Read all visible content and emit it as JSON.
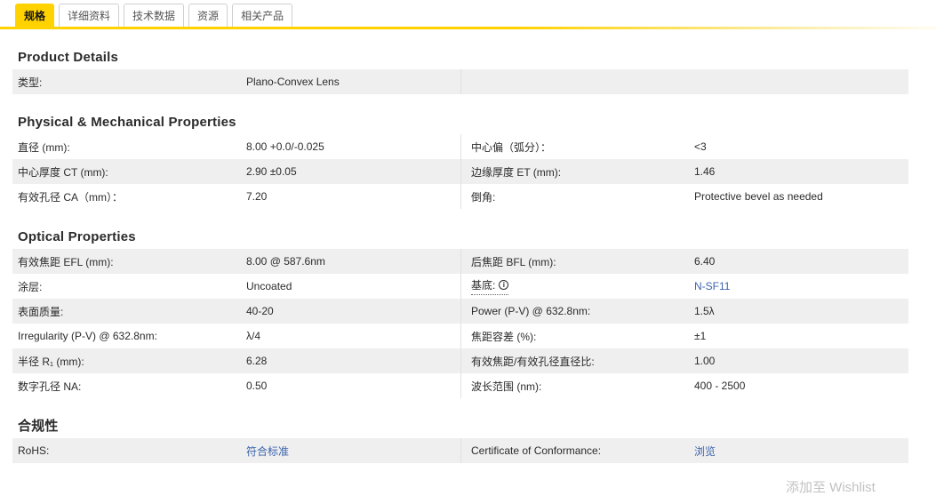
{
  "tabs": [
    {
      "label": "规格",
      "active": true
    },
    {
      "label": "详细资料",
      "active": false
    },
    {
      "label": "技术数据",
      "active": false
    },
    {
      "label": "资源",
      "active": false
    },
    {
      "label": "相关产品",
      "active": false
    }
  ],
  "icons": {
    "info": "i"
  },
  "overlay": {
    "partial_text": "添加至 Wishlist"
  },
  "colors": {
    "accent_yellow": "#ffd200",
    "row_gray": "#efefef",
    "link_blue": "#3b63ad",
    "text": "#2b2b2b"
  },
  "sections": [
    {
      "title": "Product Details",
      "rows": [
        {
          "left": {
            "label": "类型:",
            "value": "Plano-Convex Lens"
          }
        }
      ]
    },
    {
      "title": "Physical & Mechanical Properties",
      "rows": [
        {
          "left": {
            "label": "直径 (mm):",
            "value": "8.00 +0.0/-0.025"
          },
          "right": {
            "label": "中心偏（弧分）：",
            "value": "<3"
          }
        },
        {
          "left": {
            "label": "中心厚度 CT (mm):",
            "value": "2.90 ±0.05"
          },
          "right": {
            "label": "边缘厚度 ET (mm):",
            "value": "1.46"
          }
        },
        {
          "left": {
            "label": "有效孔径 CA（mm）：",
            "value": "7.20"
          },
          "right": {
            "label": "倒角:",
            "value": "Protective bevel as needed"
          }
        }
      ]
    },
    {
      "title": "Optical Properties",
      "rows": [
        {
          "left": {
            "label": "有效焦距 EFL (mm):",
            "value": "8.00 @ 587.6nm"
          },
          "right": {
            "label": "后焦距 BFL (mm):",
            "value": "6.40"
          }
        },
        {
          "left": {
            "label": "涂层:",
            "value": "Uncoated"
          },
          "right": {
            "label": "基底:",
            "value": "N-SF11"
          }
        },
        {
          "left": {
            "label": "表面质量:",
            "value": "40-20"
          },
          "right": {
            "label": "Power (P-V) @ 632.8nm:",
            "value": "1.5λ"
          }
        },
        {
          "left": {
            "label": "Irregularity (P-V) @ 632.8nm:",
            "value": "λ/4"
          },
          "right": {
            "label": "焦距容差 (%):",
            "value": "±1"
          }
        },
        {
          "left": {
            "label": "半径 R₁ (mm):",
            "value": "6.28"
          },
          "right": {
            "label": "有效焦距/有效孔径直径比:",
            "value": "1.00"
          }
        },
        {
          "left": {
            "label": "数字孔径 NA:",
            "value": "0.50"
          },
          "right": {
            "label": "波长范围 (nm):",
            "value": "400 - 2500"
          }
        }
      ]
    },
    {
      "title": "合规性",
      "rows": [
        {
          "left": {
            "label": "RoHS:",
            "value": "符合标准"
          },
          "right": {
            "label": "Certificate of Conformance:",
            "value": "浏览"
          }
        }
      ]
    }
  ]
}
